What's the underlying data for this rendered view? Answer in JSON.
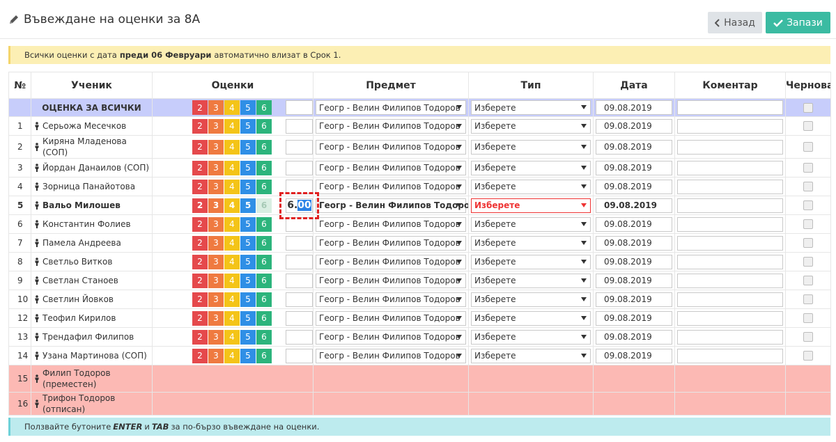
{
  "header": {
    "title": "Въвеждане на оценки за 8А",
    "back_label": "Назад",
    "save_label": "Запази",
    "icons": {
      "title": "pencil-icon",
      "back": "chevron-left-icon",
      "save": "check-icon"
    }
  },
  "alerts": {
    "warning_before": "Всички оценки с дата",
    "warning_bold": "преди 06 Февруари",
    "warning_after": "автоматично влизат в Срок 1.",
    "info_before": "Ползвайте бутоните",
    "info_key1": "ENTER",
    "info_and": "и",
    "info_key2": "TAB",
    "info_after": "за по-бързо въвеждане на оценки."
  },
  "columns": {
    "num": "№",
    "student": "Ученик",
    "grades": "Оценки",
    "subject": "Предмет",
    "type": "Тип",
    "date": "Дата",
    "comment": "Коментар",
    "draft": "Чернова"
  },
  "grade_buttons": [
    "2",
    "3",
    "4",
    "5",
    "6"
  ],
  "grade_colors": {
    "2": "#e5494c",
    "3": "#ef7a40",
    "4": "#f4c418",
    "5": "#2f8fe6",
    "6": "#2cb47c"
  },
  "all_row": {
    "label": "ОЦЕНКА ЗА ВСИЧКИ",
    "subject": "Геогр - Велин Филипов Тодоров",
    "type": "Изберете",
    "date": "09.08.2019"
  },
  "students": [
    {
      "num": "1",
      "name": "Серьожа Месечков",
      "subject": "Геогр - Велин Филипов Тодоров",
      "type": "Изберете",
      "date": "09.08.2019"
    },
    {
      "num": "2",
      "name": "Киряна Младенова (СОП)",
      "subject": "Геогр - Велин Филипов Тодоров",
      "type": "Изберете",
      "date": "09.08.2019"
    },
    {
      "num": "3",
      "name": "Йордан Данаилов (СОП)",
      "subject": "Геогр - Велин Филипов Тодоров",
      "type": "Изберете",
      "date": "09.08.2019"
    },
    {
      "num": "4",
      "name": "Зорница Панайотова",
      "subject": "Геогр - Велин Филипов Тодоров",
      "type": "Изберете",
      "date": "09.08.2019"
    },
    {
      "num": "5",
      "name": "Вальо Милошев",
      "subject": "Геогр - Велин Филипов Тодоров",
      "type": "Изберете",
      "date": "09.08.2019",
      "grade_prefix": "6.",
      "grade_selected": "00",
      "active": true
    },
    {
      "num": "6",
      "name": "Константин Фолиев",
      "subject": "Геогр - Велин Филипов Тодоров",
      "type": "Изберете",
      "date": "09.08.2019"
    },
    {
      "num": "7",
      "name": "Памела Андреева",
      "subject": "Геогр - Велин Филипов Тодоров",
      "type": "Изберете",
      "date": "09.08.2019"
    },
    {
      "num": "8",
      "name": "Светльо Витков",
      "subject": "Геогр - Велин Филипов Тодоров",
      "type": "Изберете",
      "date": "09.08.2019"
    },
    {
      "num": "9",
      "name": "Светлан Станоев",
      "subject": "Геогр - Велин Филипов Тодоров",
      "type": "Изберете",
      "date": "09.08.2019"
    },
    {
      "num": "10",
      "name": "Светлин Йовков",
      "subject": "Геогр - Велин Филипов Тодоров",
      "type": "Изберете",
      "date": "09.08.2019"
    },
    {
      "num": "12",
      "name": "Теофил Кирилов",
      "subject": "Геогр - Велин Филипов Тодоров",
      "type": "Изберете",
      "date": "09.08.2019"
    },
    {
      "num": "13",
      "name": "Трендафил Филипов",
      "subject": "Геогр - Велин Филипов Тодоров",
      "type": "Изберете",
      "date": "09.08.2019"
    },
    {
      "num": "14",
      "name": "Узана Мартинова (СОП)",
      "subject": "Геогр - Велин Филипов Тодоров",
      "type": "Изберете",
      "date": "09.08.2019"
    }
  ],
  "moved_students": [
    {
      "num": "15",
      "name": "Филип Тодоров (преместен)"
    },
    {
      "num": "16",
      "name": "Трифон Тодоров (отписан)"
    }
  ],
  "colors": {
    "accent": "#3bbba2",
    "error": "#e33333",
    "moved_row": "#fcb9b4",
    "all_row": "#c7cdfb"
  }
}
